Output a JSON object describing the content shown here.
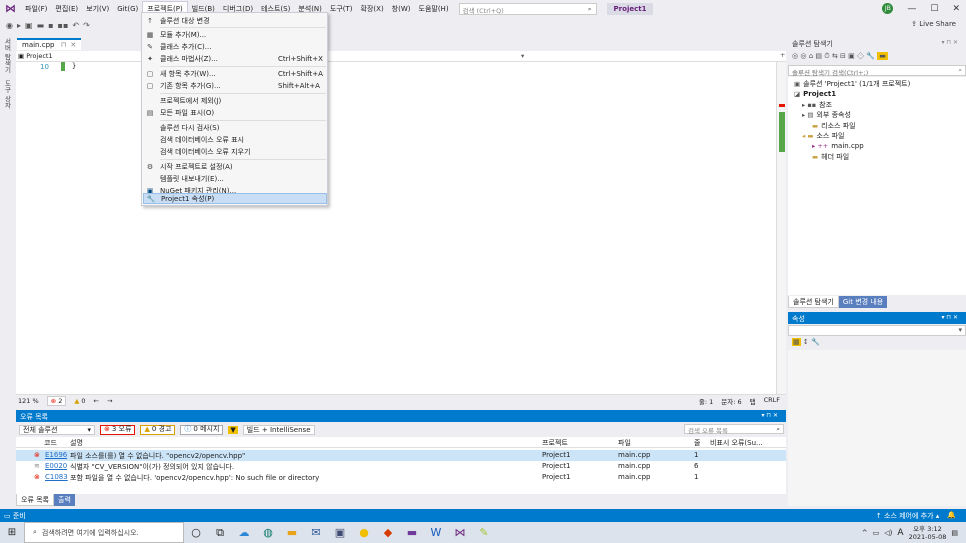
{
  "menubar": {
    "items": [
      "파일(F)",
      "편집(E)",
      "보기(V)",
      "Git(G)",
      "프로젝트(P)",
      "빌드(B)",
      "디버그(D)",
      "테스트(S)",
      "분석(N)",
      "도구(T)",
      "확장(X)",
      "창(W)",
      "도움말(H)"
    ],
    "search_placeholder": "검색 (Ctrl+Q)",
    "project_badge": "Project1",
    "avatar": "JB",
    "minimize": "—",
    "restore": "☐",
    "close": "✕"
  },
  "toolbar": {
    "liveshare": "Live Share"
  },
  "left_strip": {
    "tab1": "서버 탐색기",
    "tab2": "도구 상자"
  },
  "editor": {
    "tab_label": "main.cpp",
    "tab_close": "✕",
    "nav_project": "Project1",
    "line_number": "10",
    "code": "}",
    "zoom": "121 %",
    "errors_count": "2",
    "warnings_count": "0",
    "line": "줄: 1",
    "col": "문자: 6",
    "tabs_mode": "탭",
    "eol": "CRLF"
  },
  "project_menu": {
    "items": [
      {
        "label": "솔루션 대상 변경",
        "shortcut": "",
        "icon": "↑"
      },
      {
        "label": "모듈 추가(M)...",
        "shortcut": "",
        "icon": "▦"
      },
      {
        "label": "클래스 추가(C)...",
        "shortcut": "",
        "icon": "✎"
      },
      {
        "label": "클래스 마법사(Z)...",
        "shortcut": "Ctrl+Shift+X",
        "icon": "✦"
      },
      {
        "label": "새 항목 추가(W)...",
        "shortcut": "Ctrl+Shift+A",
        "icon": "▢"
      },
      {
        "label": "기존 항목 추가(G)...",
        "shortcut": "Shift+Alt+A",
        "icon": "▢"
      },
      {
        "label": "프로젝트에서 제외(J)",
        "shortcut": "",
        "icon": ""
      },
      {
        "label": "모든 파일 표시(O)",
        "shortcut": "",
        "icon": "▤"
      },
      {
        "label": "솔루션 다시 검사(S)",
        "shortcut": "",
        "icon": ""
      },
      {
        "label": "검색 데이터베이스 오류 표시",
        "shortcut": "",
        "icon": ""
      },
      {
        "label": "검색 데이터베이스 오류 지우기",
        "shortcut": "",
        "icon": ""
      },
      {
        "label": "시작 프로젝트로 설정(A)",
        "shortcut": "",
        "icon": "⚙"
      },
      {
        "label": "템플릿 내보내기(E)...",
        "shortcut": "",
        "icon": ""
      },
      {
        "label": "NuGet 패키지 관리(N)...",
        "shortcut": "",
        "icon": "▣"
      },
      {
        "label": "Project1 속성(P)",
        "shortcut": "",
        "icon": "🔧"
      }
    ]
  },
  "solution_explorer": {
    "title": "솔루션 탐색기",
    "pin": "▾ ⊓ ✕",
    "search_placeholder": "솔루션 탐색기 검색(Ctrl+;)",
    "tree": [
      {
        "label": "솔루션 'Project1' (1/1개 프로젝트)",
        "icon": "▣",
        "indent": 0
      },
      {
        "label": "Project1",
        "icon": "◪",
        "indent": 1
      },
      {
        "label": "참조",
        "icon": "▸ ▪▪",
        "indent": 2
      },
      {
        "label": "외부 종속성",
        "icon": "▸ ▤",
        "indent": 2
      },
      {
        "label": "리소스 파일",
        "icon": "▬",
        "indent": 2
      },
      {
        "label": "소스 파일",
        "icon": "◂ ▬",
        "indent": 2
      },
      {
        "label": "main.cpp",
        "icon": "▸ ++",
        "indent": 3
      },
      {
        "label": "헤더 파일",
        "icon": "▬",
        "indent": 2
      }
    ],
    "tab_active": "솔루션 탐색기",
    "tab_inactive": "Git 변경 내용"
  },
  "properties": {
    "title": "속성",
    "pin": "▾ ⊓ ✕"
  },
  "error_list": {
    "title": "오류 목록",
    "pin": "▾ ⊓ ✕",
    "scope": "전체 솔루션",
    "errors": "3 오류",
    "warnings": "0 경고",
    "messages": "0 메시지",
    "build_filter": "빌드 + IntelliSense",
    "search_placeholder": "검색 오류 목록",
    "columns": [
      "코드",
      "설명",
      "프로젝트",
      "파일",
      "줄",
      "비표시 오류(Su..."
    ],
    "rows": [
      {
        "code": "E1696",
        "desc": "파일 소스를(를) 열 수 없습니다. \"opencv2/opencv.hpp\"",
        "project": "Project1",
        "file": "main.cpp",
        "line": "1",
        "type": "error"
      },
      {
        "code": "E0020",
        "desc": "식별자 \"CV_VERSION\"이(가) 정의되어 있지 않습니다.",
        "project": "Project1",
        "file": "main.cpp",
        "line": "6",
        "type": "intellisense"
      },
      {
        "code": "C1083",
        "desc": "포함 파일을 열 수 없습니다. 'opencv2/opencv.hpp': No such file or directory",
        "project": "Project1",
        "file": "main.cpp",
        "line": "1",
        "type": "error"
      }
    ],
    "tab_active": "오류 목록",
    "tab_inactive": "출력"
  },
  "statusbar": {
    "ready": "준비",
    "source_control": "↑ 소스 제어에 추가 ▴"
  },
  "taskbar": {
    "search_placeholder": "검색하려면 여기에 입력하십시오.",
    "ime": "A",
    "time": "오후 3:12",
    "date": "2021-05-08"
  },
  "colors": {
    "accent": "#007acc",
    "error": "#e51400",
    "warning": "#d8a000",
    "vs_purple": "#68217a"
  }
}
